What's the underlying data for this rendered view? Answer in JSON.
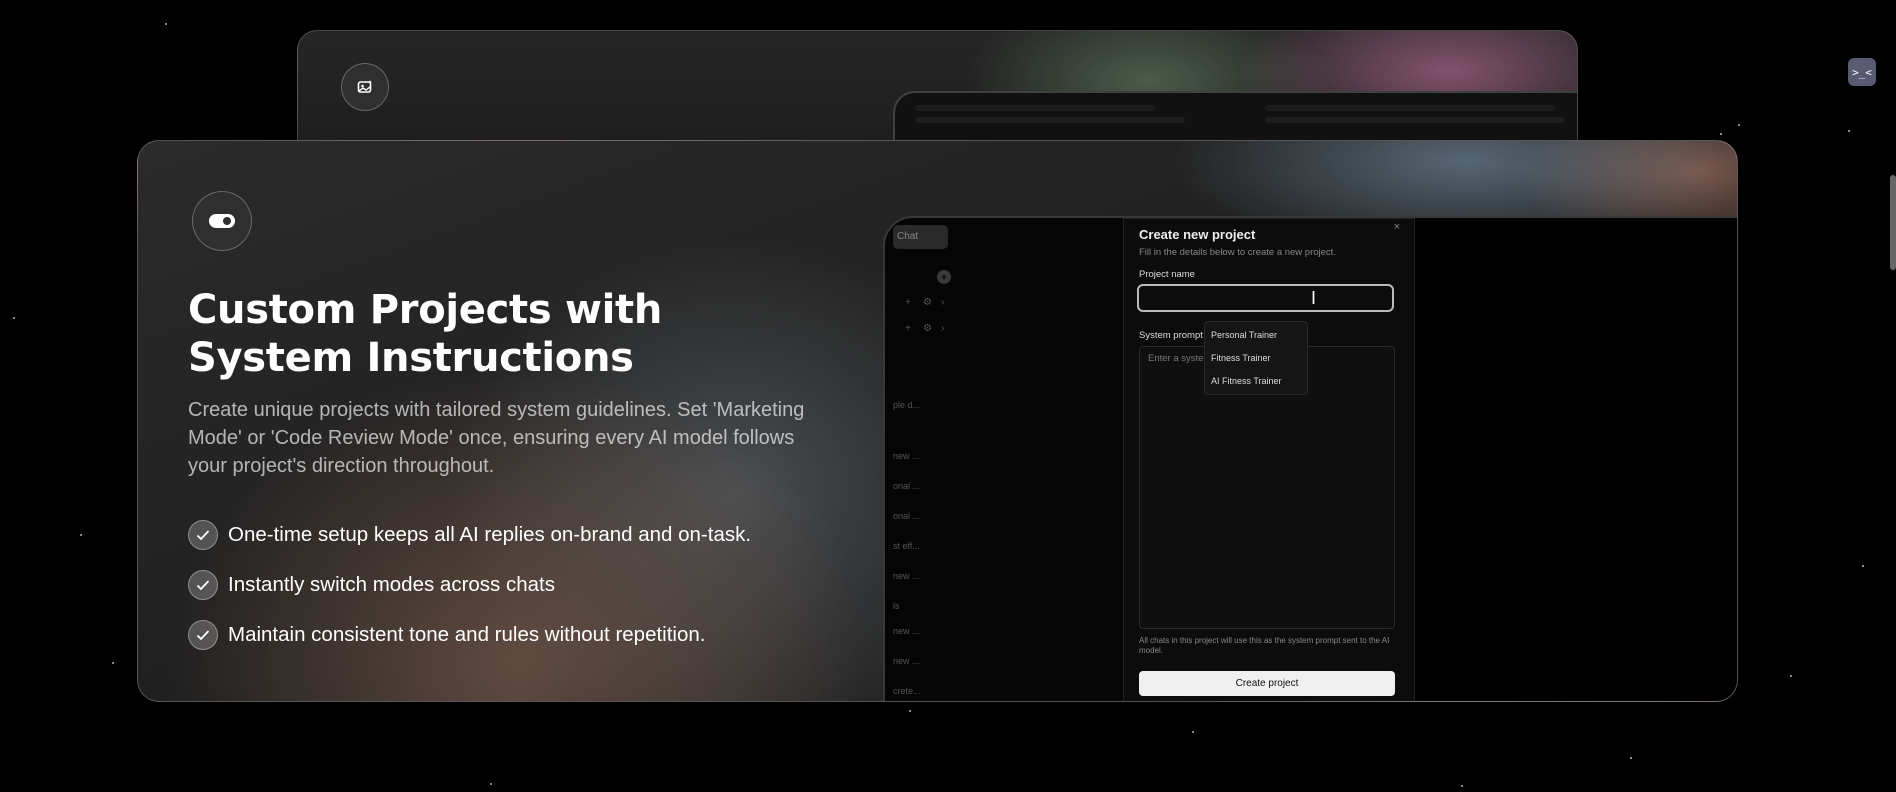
{
  "back_card": {
    "icon": "image-sparkle-icon"
  },
  "feature": {
    "icon": "toggle-icon",
    "title": "Custom Projects with System Instructions",
    "description": "Create unique projects with tailored system guidelines. Set 'Marketing Mode' or 'Code Review Mode' once, ensuring every AI model follows your project's direction throughout.",
    "bullets": [
      "One-time setup keeps all AI replies on-brand and on-task.",
      "Instantly switch modes across chats",
      "Maintain consistent tone and rules without repetition."
    ]
  },
  "screenshot": {
    "sidebar": {
      "tab": "Chat",
      "items": [
        "ple d...",
        "new ...",
        "onal ...",
        "onal ...",
        "st eff...",
        "new ...",
        "ls",
        "new ...",
        "new ...",
        "crete..."
      ]
    },
    "dialog": {
      "title": "Create new project",
      "close": "×",
      "subtitle": "Fill in the details below to create a new project.",
      "name_label": "Project name",
      "name_value": "",
      "prompt_label": "System prompt",
      "prompt_placeholder": "Enter a system prompt for this project",
      "suggestions": [
        "Personal Trainer",
        "Fitness Trainer",
        "AI Fitness Trainer"
      ],
      "hint": "All chats in this project will use this as the system prompt sent to the AI model.",
      "create_button": "Create project"
    }
  },
  "corner_button": {
    "label": ">_<",
    "icon": "face-icon"
  }
}
